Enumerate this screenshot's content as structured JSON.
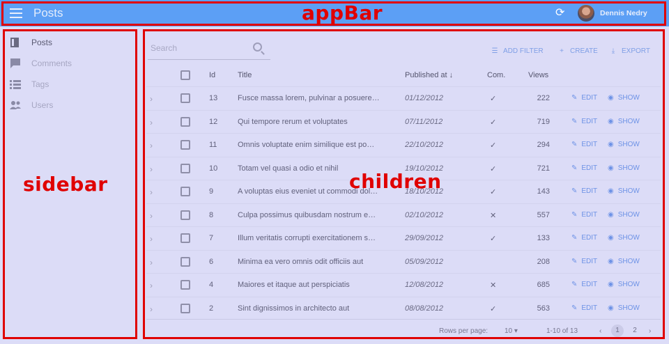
{
  "app_bar": {
    "title": "Posts",
    "user_name": "Dennis Nedry",
    "refresh_icon": "refresh-icon",
    "menu_icon": "menu-icon"
  },
  "sidebar": {
    "items": [
      {
        "label": "Posts",
        "icon": "posts-icon"
      },
      {
        "label": "Comments",
        "icon": "comments-icon"
      },
      {
        "label": "Tags",
        "icon": "tags-icon"
      },
      {
        "label": "Users",
        "icon": "users-icon"
      }
    ]
  },
  "list": {
    "search_placeholder": "Search",
    "toolbar": {
      "add_filter": "ADD FILTER",
      "create": "CREATE",
      "export": "EXPORT"
    },
    "headers": {
      "id": "Id",
      "title": "Title",
      "published": "Published at",
      "commentable": "Com.",
      "views": "Views"
    },
    "rows": [
      {
        "id": "13",
        "title": "Fusce massa lorem, pulvinar a posuere…",
        "published": "01/12/2012",
        "commentable": "✓",
        "views": "222"
      },
      {
        "id": "12",
        "title": "Qui tempore rerum et voluptates",
        "published": "07/11/2012",
        "commentable": "✓",
        "views": "719"
      },
      {
        "id": "11",
        "title": "Omnis voluptate enim similique est po…",
        "published": "22/10/2012",
        "commentable": "✓",
        "views": "294"
      },
      {
        "id": "10",
        "title": "Totam vel quasi a odio et nihil",
        "published": "19/10/2012",
        "commentable": "✓",
        "views": "721"
      },
      {
        "id": "9",
        "title": "A voluptas eius eveniet ut commodi dol…",
        "published": "18/10/2012",
        "commentable": "✓",
        "views": "143"
      },
      {
        "id": "8",
        "title": "Culpa possimus quibusdam nostrum e…",
        "published": "02/10/2012",
        "commentable": "✕",
        "views": "557"
      },
      {
        "id": "7",
        "title": "Illum veritatis corrupti exercitationem s…",
        "published": "29/09/2012",
        "commentable": "✓",
        "views": "133"
      },
      {
        "id": "6",
        "title": "Minima ea vero omnis odit officiis aut",
        "published": "05/09/2012",
        "commentable": "",
        "views": "208"
      },
      {
        "id": "4",
        "title": "Maiores et itaque aut perspiciatis",
        "published": "12/08/2012",
        "commentable": "✕",
        "views": "685"
      },
      {
        "id": "2",
        "title": "Sint dignissimos in architecto aut",
        "published": "08/08/2012",
        "commentable": "✓",
        "views": "563"
      }
    ],
    "row_actions": {
      "edit": "EDIT",
      "show": "SHOW"
    },
    "footer": {
      "rows_per_page_label": "Rows per page:",
      "rows_per_page_value": "10",
      "range": "1-10 of 13",
      "pages": [
        "1",
        "2"
      ]
    }
  },
  "annotations": {
    "app_bar": "appBar",
    "sidebar": "sidebar",
    "children": "children"
  },
  "colors": {
    "annotation": "#e00000",
    "app_bar": "#5c9ff5",
    "accent": "#6d92e6"
  }
}
